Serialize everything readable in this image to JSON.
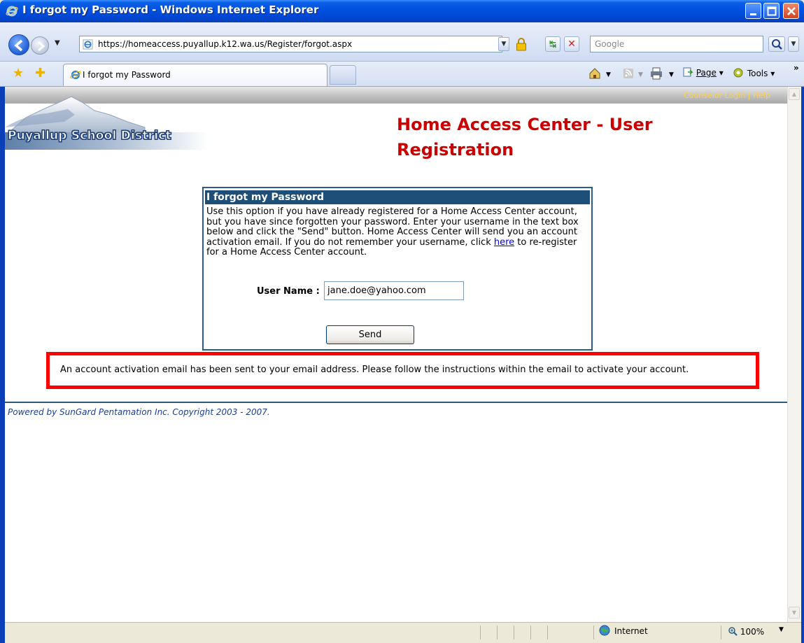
{
  "window": {
    "title": "I forgot my Password - Windows Internet Explorer"
  },
  "toolbar": {
    "address": "https://homeaccess.puyallup.k12.wa.us/Register/forgot.aspx",
    "search_placeholder": "Google"
  },
  "tabs": [
    {
      "label": "I forgot my Password"
    }
  ],
  "commandbar": {
    "page_label": "Page",
    "tools_label": "Tools",
    "more": "»"
  },
  "page": {
    "top_links": "Counselor Login | Help",
    "logo_text": "Puyallup School District",
    "heading": "Home Access Center - User Registration",
    "panel": {
      "title": "I forgot my Password",
      "body_before": "Use this option if you have already registered for a Home Access Center account, but you have since forgotten your password. Enter your username in the text box below and click the \"Send\" button. Home Access Center will send you an account activation email. If you do not remember your username, click ",
      "link_text": "here",
      "body_after": " to re-register for a Home Access Center account.",
      "username_label": "User Name :",
      "username_value": "jane.doe@yahoo.com",
      "send_label": "Send"
    },
    "notice": "An account activation email has been sent to your email address. Please follow the instructions within the email to activate your account.",
    "footer": "Powered by SunGard Pentamation Inc. Copyright 2003 - 2007."
  },
  "status": {
    "zone": "Internet",
    "zoom": "100%"
  },
  "colors": {
    "heading": "#cc0000",
    "panel_title_bg": "#1e4f78",
    "notice_border": "#ff0000",
    "link": "#0000ee"
  }
}
